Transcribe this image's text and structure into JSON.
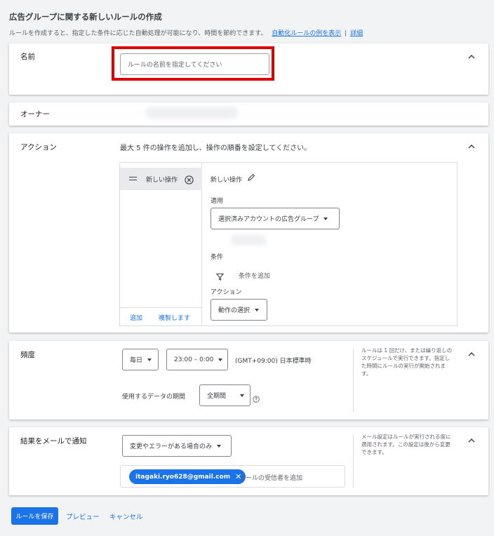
{
  "header": {
    "title": "広告グループに関する新しいルールの作成",
    "subtitle": "ルールを作成すると、指定した条件に応じた自動処理が可能になり、時間を節約できます。",
    "examples_link": "自動化ルールの例を表示",
    "separator": "|",
    "details_link": "詳細"
  },
  "name_section": {
    "label": "名前",
    "input_placeholder": "ルールの名前を指定してください"
  },
  "owner_section": {
    "label": "オーナー"
  },
  "action_section": {
    "label": "アクション",
    "instruction": "最大 5 件の操作を追加し、操作の順番を設定してください。",
    "list_item": "新しい操作",
    "add_link": "追加",
    "duplicate_link": "複製します",
    "detail_title": "新しい操作",
    "apply_label": "適用",
    "apply_value": "選択済みアカウントの広告グループ",
    "condition_label": "条件",
    "add_condition": "条件を追加",
    "action_label": "アクション",
    "action_select": "動作の選択"
  },
  "frequency_section": {
    "label": "頻度",
    "frequency_value": "毎日",
    "time_value": "23:00 – 0:00",
    "timezone": "(GMT+09:00) 日本標準時",
    "data_period_label": "使用するデータの期間",
    "data_period_value": "全期間",
    "side_note": "ルールは 1 回だけ、または繰り返しのスケジュールで実行できます。指定した時間にルールの実行が開始されます。"
  },
  "email_section": {
    "label": "結果をメールで通知",
    "notify_value": "変更やエラーがある場合のみ",
    "recipient_chip": "itagaki.ryo628@gmail.com",
    "recipient_placeholder": "メールの受信者を追加",
    "side_note": "メール設定はルールが実行される度に適用されます。この設定は後から変更できます。"
  },
  "footer": {
    "save_label": "ルールを保存",
    "preview_label": "プレビュー",
    "cancel_label": "キャンセル"
  },
  "colors": {
    "accent": "#1a73e8",
    "highlight": "#e00000",
    "background": "#f1f3f4"
  }
}
